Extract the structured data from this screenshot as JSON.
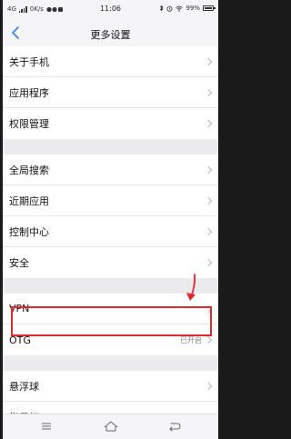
{
  "status_bar": {
    "network": "4G",
    "speed": "0K/s",
    "time": "11:06",
    "battery": "99%",
    "battery_level": 0.99,
    "icons": [
      "signal-icon",
      "notification-icons",
      "bluetooth-icon",
      "alarm-icon",
      "wifi-icon",
      "battery-icon"
    ]
  },
  "header": {
    "title": "更多设置",
    "back_icon": "chevron-left-icon"
  },
  "groups": [
    {
      "items": [
        {
          "label": "关于手机",
          "value": ""
        },
        {
          "label": "应用程序",
          "value": ""
        },
        {
          "label": "权限管理",
          "value": ""
        }
      ]
    },
    {
      "items": [
        {
          "label": "全局搜索",
          "value": ""
        },
        {
          "label": "近期应用",
          "value": ""
        },
        {
          "label": "控制中心",
          "value": ""
        },
        {
          "label": "安全",
          "value": ""
        }
      ]
    },
    {
      "items": [
        {
          "label": "VPN",
          "value": ""
        },
        {
          "label": "OTG",
          "value": "已开启"
        }
      ]
    },
    {
      "items": [
        {
          "label": "悬浮球",
          "value": ""
        },
        {
          "label": "指示灯",
          "value": ""
        }
      ]
    }
  ],
  "annotation": {
    "highlight_color": "#e0282e",
    "highlighted_item": "OTG"
  },
  "nav_buttons": [
    "menu-icon",
    "home-icon",
    "back-icon"
  ],
  "colors": {
    "accent": "#1a73e8",
    "background": "#f0f0f2"
  }
}
